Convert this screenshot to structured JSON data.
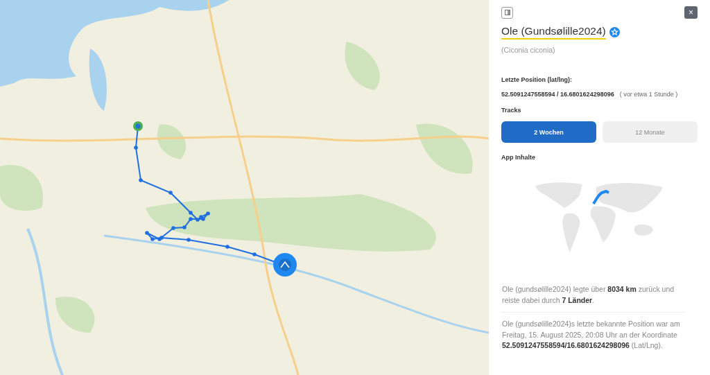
{
  "panel": {
    "close": "×",
    "title": "Ole (Gundsølille2024)",
    "verified": true,
    "species": "(Ciconia ciconia)",
    "position_label": "Letzte Position (lat/lng):",
    "position_value": "52.5091247558594 / 16.6801624298096",
    "position_age": "( vor etwa 1 Stunde )",
    "tracks_label": "Tracks",
    "tracks": [
      {
        "label": "2 Wochen",
        "selected": true
      },
      {
        "label": "12 Monate",
        "selected": false
      }
    ],
    "app_label": "App Inhalte",
    "summary": "Ole (gundsølille2024) legte über **8034 km** zurück und reiste dabei durch **7 Länder**.",
    "last_known": "Ole (gundsølille2024)s letzte bekannte Position war am Freitag, 15. August 2025, 20:08 Uhr an der Koordinate **52.5091247558594/16.6801624298096** (Lat/Lng)."
  }
}
